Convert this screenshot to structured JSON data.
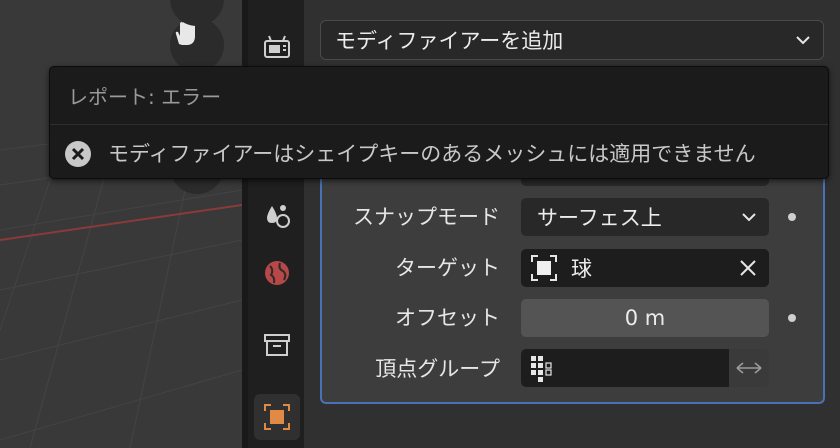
{
  "add_modifier": {
    "label": "モディファイアーを追加"
  },
  "report": {
    "title": "レポート: エラー",
    "message": "モディファイアーはシェイプキーのあるメッシュには適用できません"
  },
  "panel": {
    "snap_mode": {
      "label": "スナップモード",
      "value": "サーフェス上"
    },
    "target": {
      "label": "ターゲット",
      "value": "球"
    },
    "offset": {
      "label": "オフセット",
      "value": "0 m"
    },
    "vertex_group": {
      "label": "頂点グループ",
      "value": ""
    }
  },
  "colors": {
    "accent": "#4772b3",
    "background": "#303030",
    "tooltip": "#1b1b1b",
    "object_tab": "#e08a46",
    "x_axis": "#8a3a3a"
  },
  "icons": {
    "tabs": [
      "render-icon",
      "physics-icon",
      "world-icon",
      "collection-icon",
      "object-icon"
    ],
    "viewport": [
      "hand-icon"
    ]
  }
}
